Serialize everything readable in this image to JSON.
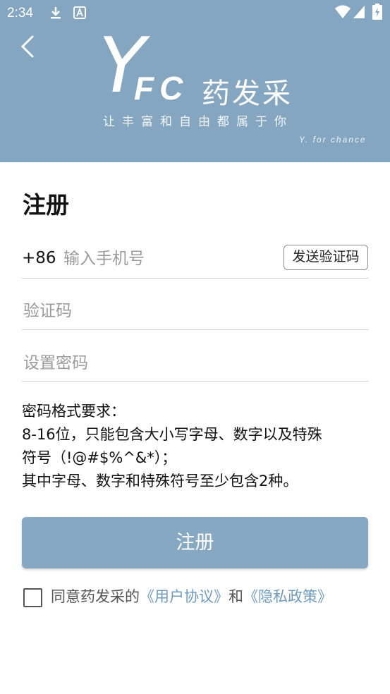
{
  "status_bar": {
    "time": "2:34",
    "icons": [
      "download-icon",
      "a-notification-icon",
      "wifi-icon",
      "signal-icon",
      "battery-icon"
    ]
  },
  "header": {
    "logo_y": "Y",
    "logo_fc": "FC",
    "logo_cn": "药发采",
    "slogan": "让丰富和自由都属于你",
    "slogan_en": "Y. for chance",
    "background": "#84a6c1"
  },
  "page_title": "注册",
  "phone": {
    "prefix": "+86",
    "placeholder": "输入手机号",
    "send_code_label": "发送验证码"
  },
  "code": {
    "placeholder": "验证码"
  },
  "password": {
    "placeholder": "设置密码"
  },
  "rules": {
    "line1": "密码格式要求：",
    "line2": "8-16位，只能包含大小写字母、数字以及特殊",
    "line3": "符号（!@#$%^&*）；",
    "line4": "其中字母、数字和特殊符号至少包含2种。"
  },
  "submit_label": "注册",
  "agreement": {
    "prefix": "同意药发采的",
    "user_agreement": "《用户协议》",
    "and": "和",
    "privacy_policy": "《隐私政策》",
    "checked": false,
    "link_color": "#6f9bc0"
  }
}
